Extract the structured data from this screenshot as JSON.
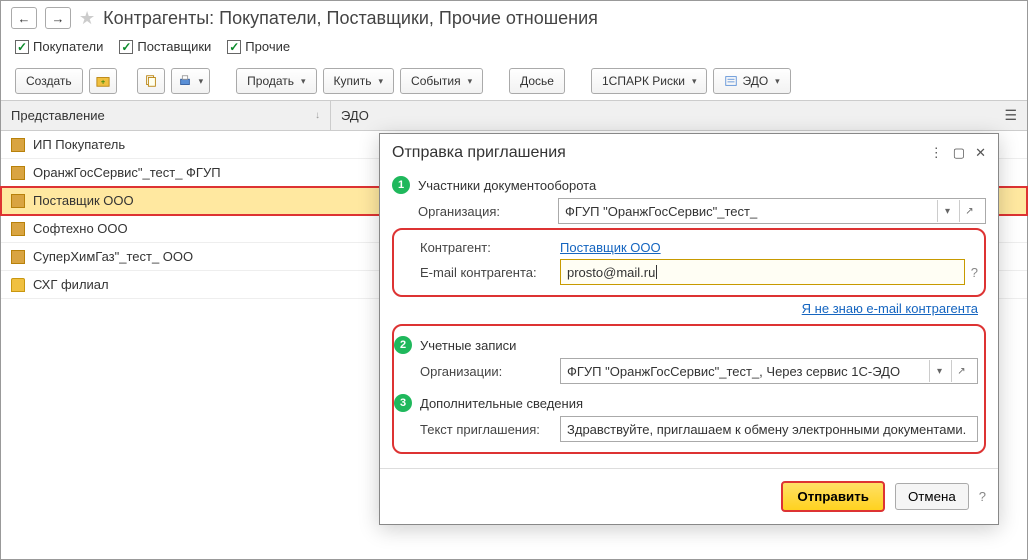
{
  "header": {
    "title": "Контрагенты: Покупатели, Поставщики, Прочие отношения"
  },
  "filters": {
    "buyers": "Покупатели",
    "suppliers": "Поставщики",
    "others": "Прочие"
  },
  "toolbar": {
    "create": "Создать",
    "sell": "Продать",
    "buy": "Купить",
    "events": "События",
    "dossier": "Досье",
    "spark": "1СПАРК Риски",
    "edo": "ЭДО"
  },
  "grid": {
    "col_name": "Представление",
    "col_edo": "ЭДО",
    "rows": [
      {
        "label": "ИП Покупатель"
      },
      {
        "label": "ОранжГосСервис\"_тест_ ФГУП"
      },
      {
        "label": "Поставщик ООО"
      },
      {
        "label": "Софтехно ООО"
      },
      {
        "label": "СуперХимГаз\"_тест_ ООО"
      },
      {
        "label": "СХГ филиал"
      }
    ]
  },
  "dialog": {
    "title": "Отправка приглашения",
    "step1": "Участники документооборота",
    "org_label": "Организация:",
    "org_value": "ФГУП \"ОранжГосСервис\"_тест_",
    "contractor_label": "Контрагент:",
    "contractor_value": "Поставщик ООО",
    "email_label": "E-mail контрагента:",
    "email_value": "prosto@mail.ru",
    "unknown_email": "Я не знаю e-mail контрагента",
    "step2": "Учетные записи",
    "accounts_label": "Организации:",
    "accounts_value": "ФГУП \"ОранжГосСервис\"_тест_, Через сервис 1С-ЭДО",
    "step3": "Дополнительные сведения",
    "invite_text_label": "Текст приглашения:",
    "invite_text_value": "Здравствуйте, приглашаем к обмену электронными документами.",
    "send": "Отправить",
    "cancel": "Отмена"
  }
}
